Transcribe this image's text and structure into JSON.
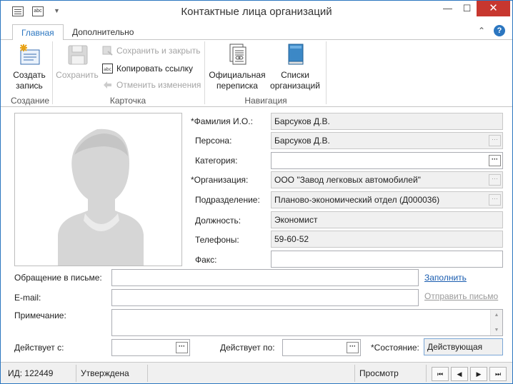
{
  "window": {
    "title": "Контактные лица организаций",
    "minimize": "—",
    "maximize": "☐",
    "close": "✕"
  },
  "ribbon": {
    "tabs": [
      "Главная",
      "Дополнительно"
    ],
    "help": "?",
    "groups": {
      "create": "Создание",
      "card": "Карточка",
      "nav": "Навигация"
    },
    "buttons": {
      "create": "Создать запись",
      "save": "Сохранить",
      "save_close": "Сохранить и закрыть",
      "copy_link": "Копировать ссылку",
      "cancel_changes": "Отменить изменения",
      "official_corr": "Официальная переписка",
      "org_lists": "Списки организаций"
    }
  },
  "form": {
    "fio": {
      "label": "*Фамилия И.О.:",
      "value": "Барсуков Д.В."
    },
    "person": {
      "label": "Персона:",
      "value": "Барсуков Д.В."
    },
    "category": {
      "label": "Категория:",
      "value": ""
    },
    "org": {
      "label": "*Организация:",
      "value": "ООО \"Завод легковых автомобилей\""
    },
    "dept": {
      "label": "Подразделение:",
      "value": "Планово-экономический отдел (Д000036)"
    },
    "position": {
      "label": "Должность:",
      "value": "Экономист"
    },
    "phones": {
      "label": "Телефоны:",
      "value": "59-60-52"
    },
    "fax": {
      "label": "Факс:",
      "value": ""
    },
    "salutation": {
      "label": "Обращение в письме:",
      "value": "",
      "action": "Заполнить"
    },
    "email": {
      "label": "E-mail:",
      "value": "",
      "action": "Отправить письмо"
    },
    "note": {
      "label": "Примечание:",
      "value": ""
    },
    "valid_from": {
      "label": "Действует с:",
      "value": ""
    },
    "valid_to": {
      "label": "Действует по:",
      "value": ""
    },
    "state": {
      "label": "*Состояние:",
      "value": "Действующая"
    },
    "ellipsis": "···"
  },
  "statusbar": {
    "id": "ИД: 122449",
    "status": "Утверждена",
    "mode": "Просмотр",
    "nav": [
      "⏮",
      "◀",
      "▶",
      "⏭"
    ]
  }
}
